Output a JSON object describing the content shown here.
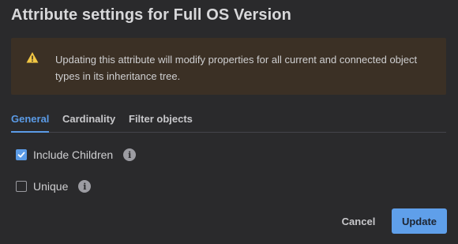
{
  "dialog": {
    "title": "Attribute settings for Full OS Version"
  },
  "warning": {
    "icon": "warning-triangle-icon",
    "icon_color": "#f2c744",
    "background": "#3b3025",
    "text": "Updating this attribute will modify properties for all current and connected object types in its inheritance tree."
  },
  "tabs": [
    {
      "label": "General",
      "active": true
    },
    {
      "label": "Cardinality",
      "active": false
    },
    {
      "label": "Filter objects",
      "active": false
    }
  ],
  "options": [
    {
      "label": "Include Children",
      "checked": true,
      "info_icon": "info-icon"
    },
    {
      "label": "Unique",
      "checked": false,
      "info_icon": "info-icon"
    }
  ],
  "actions": {
    "cancel_label": "Cancel",
    "update_label": "Update"
  },
  "colors": {
    "accent": "#5b9be6",
    "background": "#2a2a2c"
  }
}
